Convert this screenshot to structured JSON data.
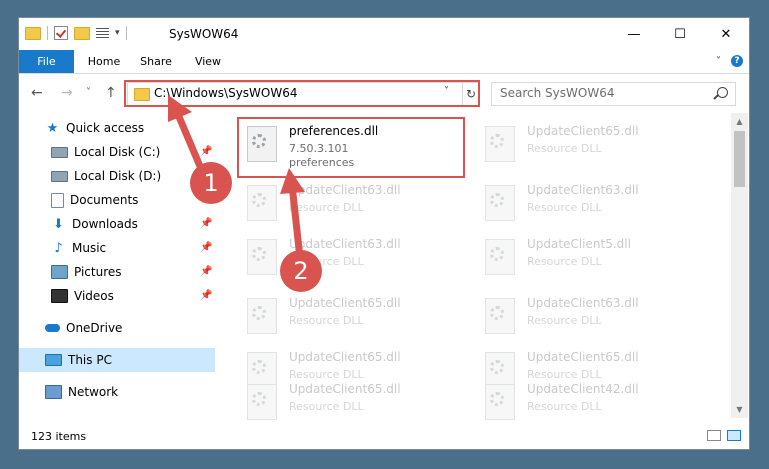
{
  "window": {
    "title": "SysWOW64",
    "controls": {
      "minimize": "—",
      "maximize": "☐",
      "close": "✕"
    },
    "quick_access_toolbar": {
      "dropdown": "▾"
    }
  },
  "ribbon": {
    "tabs": [
      {
        "label": "File",
        "active": true
      },
      {
        "label": "Home"
      },
      {
        "label": "Share"
      },
      {
        "label": "View"
      }
    ],
    "expand_glyph": "˅",
    "help_glyph": "?"
  },
  "navigation": {
    "back": "←",
    "forward": "→",
    "recent": "˅",
    "up": "↑",
    "address": "C:\\Windows\\SysWOW64",
    "address_dropdown": "˅",
    "refresh": "↻",
    "search_placeholder": "Search SysWOW64"
  },
  "sidebar": {
    "items": [
      {
        "label": "Quick access",
        "icon": "star-icon",
        "pinned": false
      },
      {
        "label": "Local Disk (C:)",
        "icon": "drive-icon",
        "pinned": true
      },
      {
        "label": "Local Disk (D:)",
        "icon": "drive-icon",
        "pinned": false
      },
      {
        "label": "Documents",
        "icon": "documents-icon",
        "pinned": true
      },
      {
        "label": "Downloads",
        "icon": "downloads-icon",
        "pinned": true
      },
      {
        "label": "Music",
        "icon": "music-icon",
        "pinned": true
      },
      {
        "label": "Pictures",
        "icon": "pictures-icon",
        "pinned": true
      },
      {
        "label": "Videos",
        "icon": "videos-icon",
        "pinned": true
      },
      {
        "label": "OneDrive",
        "icon": "onedrive-icon",
        "pinned": false
      },
      {
        "label": "This PC",
        "icon": "this-pc-icon",
        "pinned": false,
        "selected": true
      },
      {
        "label": "Network",
        "icon": "network-icon",
        "pinned": false
      }
    ],
    "pin_glyph": "📌"
  },
  "files": {
    "highlighted": {
      "name": "preferences.dll",
      "version": "7.50.3.101",
      "description": "preferences"
    },
    "faded": [
      {
        "name": "UpdateClient65.dll",
        "description": "Resource DLL"
      },
      {
        "name": "UpdateClient63.dll",
        "description": "Resource DLL"
      },
      {
        "name": "UpdateClient63.dll",
        "description": "Resource DLL"
      },
      {
        "name": "UpdateClient63.dll",
        "description": "Resource DLL"
      },
      {
        "name": "UpdateClient5.dll",
        "description": "Resource DLL"
      },
      {
        "name": "UpdateClient65.dll",
        "description": "Resource DLL"
      },
      {
        "name": "UpdateClient63.dll",
        "description": "Resource DLL"
      },
      {
        "name": "UpdateClient65.dll",
        "description": "Resource DLL"
      },
      {
        "name": "UpdateClient65.dll",
        "description": "Resource DLL"
      },
      {
        "name": "UpdateClient42.dll",
        "description": "Resource DLL"
      }
    ]
  },
  "status": {
    "item_count": "123 items"
  },
  "annotations": {
    "step1": "1",
    "step2": "2",
    "color": "#d9534f"
  }
}
